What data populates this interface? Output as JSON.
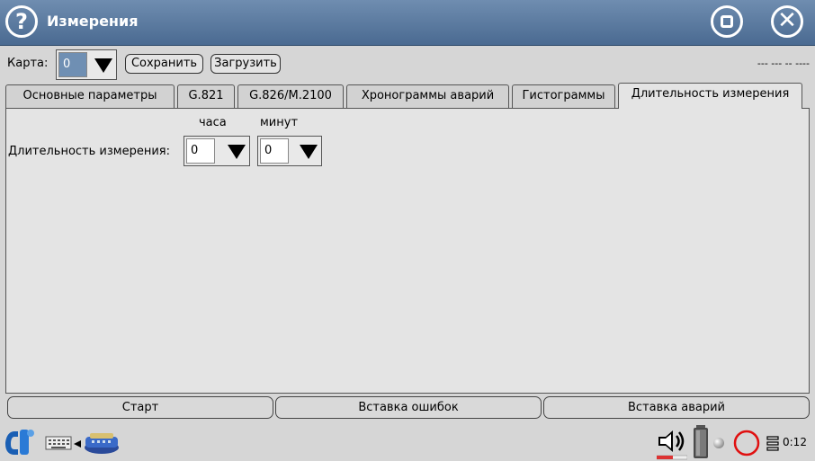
{
  "window": {
    "title": "Измерения"
  },
  "toolbar": {
    "card_label": "Карта:",
    "card_value": "0",
    "save_label": "Сохранить",
    "load_label": "Загрузить",
    "status": "--- --- -- ----"
  },
  "tabs": [
    {
      "label": "Основные параметры",
      "active": false
    },
    {
      "label": "G.821",
      "active": false
    },
    {
      "label": "G.826/M.2100",
      "active": false
    },
    {
      "label": "Хронограммы аварий",
      "active": false
    },
    {
      "label": "Гистограммы",
      "active": false
    },
    {
      "label": "Длительность измерения",
      "active": true
    }
  ],
  "duration": {
    "hours_header": "часа",
    "minutes_header": "минут",
    "label": "Длительность измерения:",
    "hours_value": "0",
    "minutes_value": "0"
  },
  "actions": {
    "start": "Старт",
    "insert_errors": "Вставка ошибок",
    "insert_alarms": "Вставка аварий"
  },
  "taskbar": {
    "time": "0:12",
    "icons": [
      "app-menu-icon",
      "keyboard-icon",
      "scroll-arrow-icon",
      "network-icon",
      "speaker-icon",
      "battery-icon",
      "led-indicator-icon",
      "record-icon",
      "list-icon"
    ]
  },
  "colors": {
    "titlebar": "#5a7aa0",
    "selected_value": "#6f8fb3",
    "background": "#d6d6d6"
  }
}
